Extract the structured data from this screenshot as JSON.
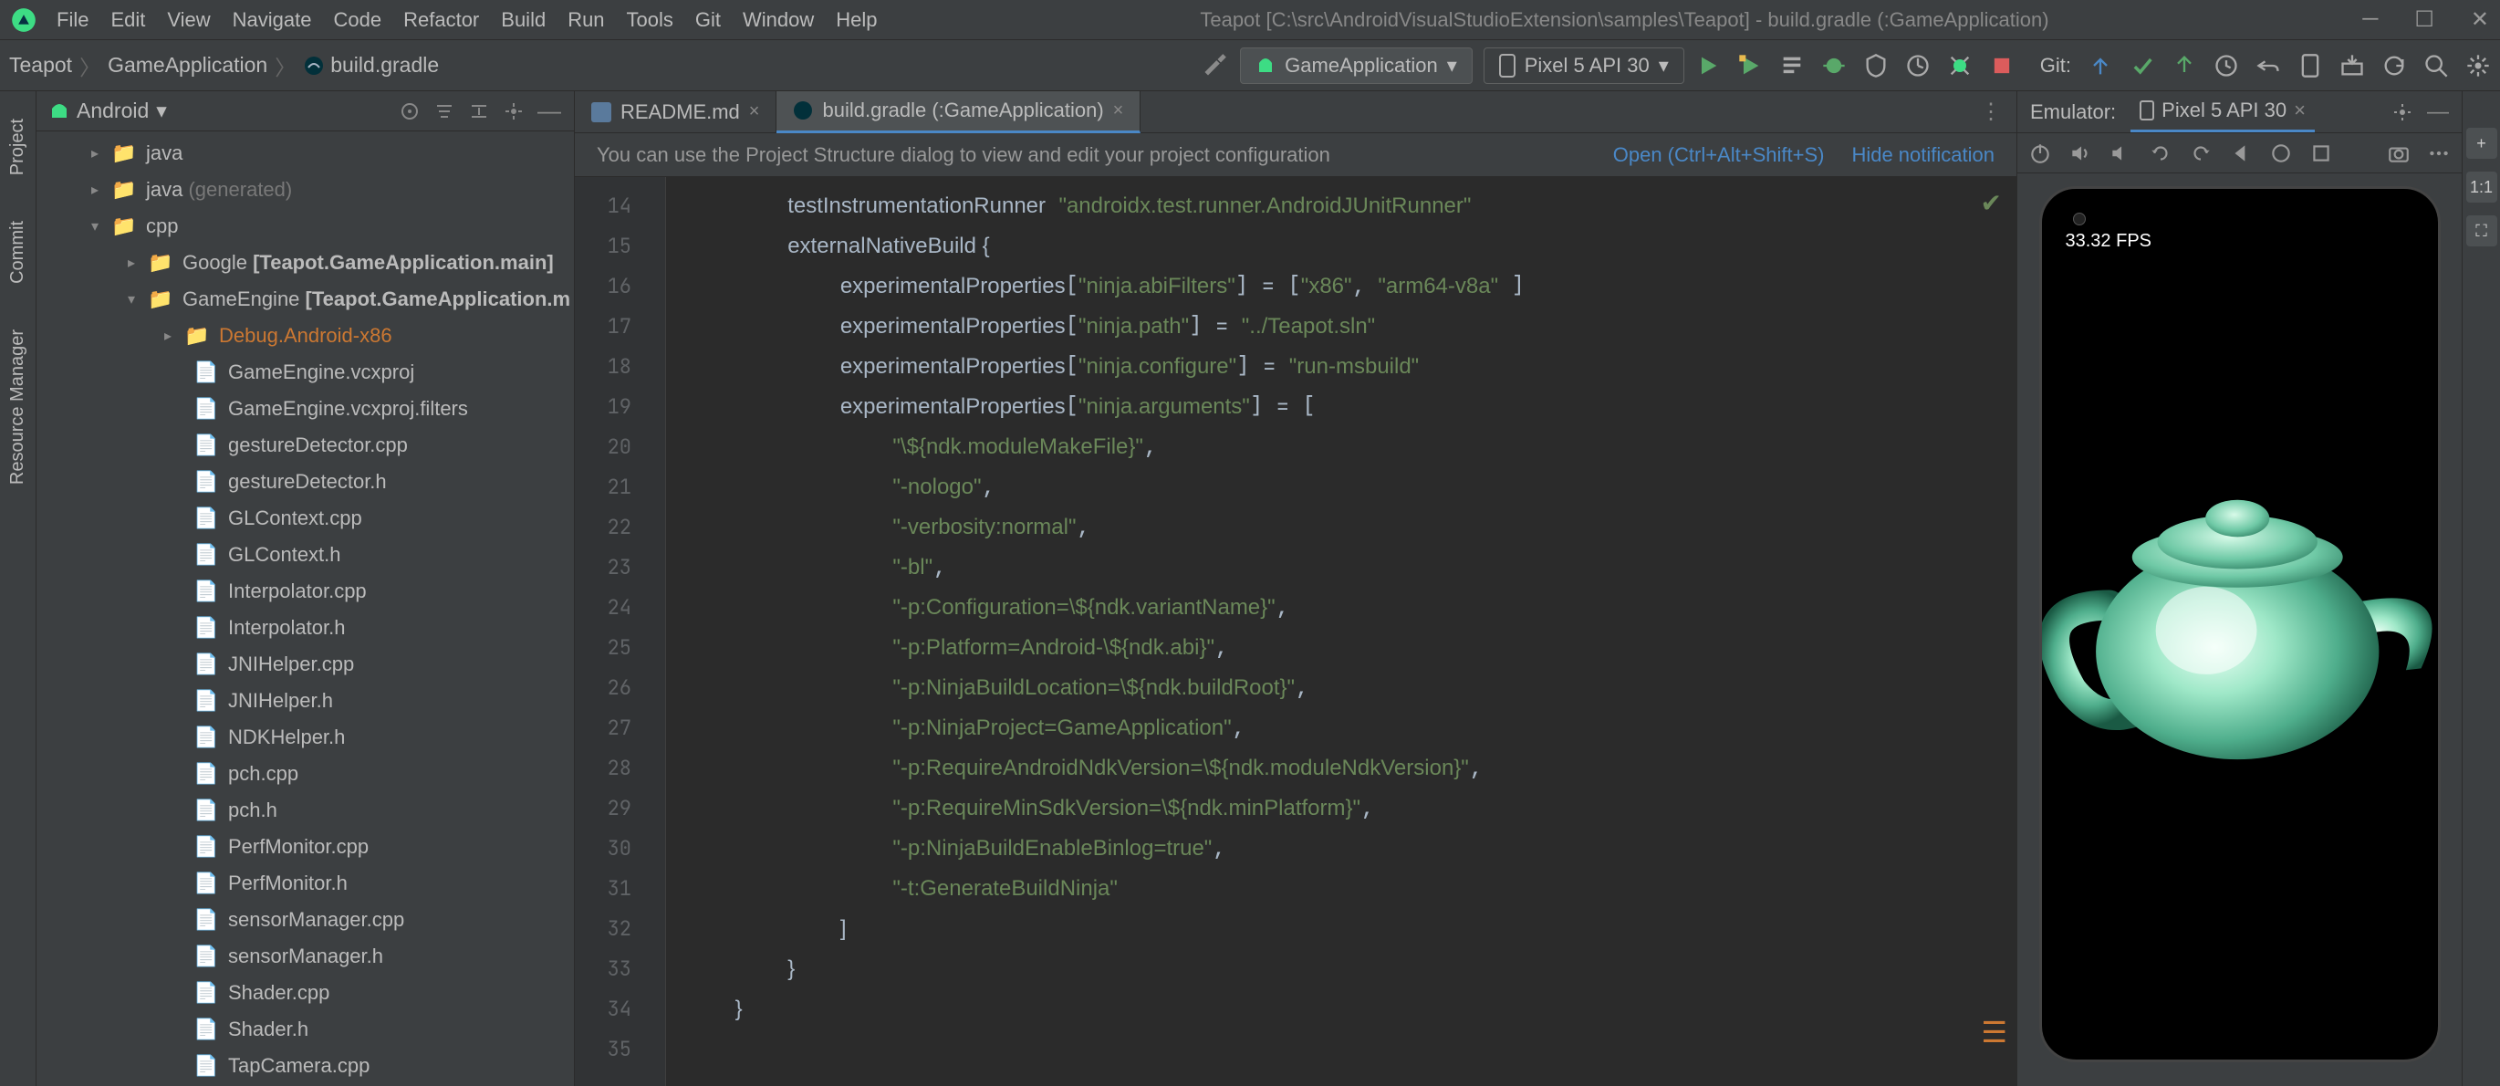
{
  "menus": [
    "File",
    "Edit",
    "View",
    "Navigate",
    "Code",
    "Refactor",
    "Build",
    "Run",
    "Tools",
    "Git",
    "Window",
    "Help"
  ],
  "window_title": "Teapot [C:\\src\\AndroidVisualStudioExtension\\samples\\Teapot] - build.gradle (:GameApplication)",
  "breadcrumb": {
    "project": "Teapot",
    "module": "GameApplication",
    "file": "build.gradle"
  },
  "run_config": "GameApplication",
  "device_selector": "Pixel 5 API 30",
  "git_label": "Git:",
  "project_panel": {
    "mode": "Android"
  },
  "tree": {
    "java": "java",
    "java_gen": "java",
    "java_gen_suffix": "(generated)",
    "cpp": "cpp",
    "google": "Google",
    "google_suffix": "[Teapot.GameApplication.main]",
    "gameengine": "GameEngine",
    "gameengine_suffix": "[Teapot.GameApplication.m",
    "debug": "Debug.Android-x86",
    "files": [
      "GameEngine.vcxproj",
      "GameEngine.vcxproj.filters",
      "gestureDetector.cpp",
      "gestureDetector.h",
      "GLContext.cpp",
      "GLContext.h",
      "Interpolator.cpp",
      "Interpolator.h",
      "JNIHelper.cpp",
      "JNIHelper.h",
      "NDKHelper.h",
      "pch.cpp",
      "pch.h",
      "PerfMonitor.cpp",
      "PerfMonitor.h",
      "sensorManager.cpp",
      "sensorManager.h",
      "Shader.cpp",
      "Shader.h",
      "TapCamera.cpp"
    ]
  },
  "tabs": [
    {
      "label": "README.md",
      "active": false
    },
    {
      "label": "build.gradle (:GameApplication)",
      "active": true
    }
  ],
  "notification": {
    "msg": "You can use the Project Structure dialog to view and edit your project configuration",
    "open": "Open (Ctrl+Alt+Shift+S)",
    "hide": "Hide notification"
  },
  "gutter_start": 14,
  "gutter_end": 35,
  "code": {
    "l14": {
      "indent": "        ",
      "id": "testInstrumentationRunner",
      "str": "\"androidx.test.runner.AndroidJUnitRunner\""
    },
    "l15": {
      "indent": "        ",
      "id": "externalNativeBuild",
      "br": " {"
    },
    "l16": {
      "indent": "            ",
      "id": "experimentalProperties",
      "op": "[",
      "str": "\"ninja.abiFilters\"",
      "op2": "] = [",
      "str2": "\"x86\"",
      "comma": ", ",
      "str3": "\"arm64-v8a\"",
      "close": " ]"
    },
    "l17": {
      "indent": "            ",
      "id": "experimentalProperties",
      "op": "[",
      "str": "\"ninja.path\"",
      "op2": "] = ",
      "str2": "\"../Teapot.sln\""
    },
    "l18": {
      "indent": "            ",
      "id": "experimentalProperties",
      "op": "[",
      "str": "\"ninja.configure\"",
      "op2": "] = ",
      "str2": "\"run-msbuild\""
    },
    "l19": {
      "indent": "            ",
      "id": "experimentalProperties",
      "op": "[",
      "str": "\"ninja.arguments\"",
      "op2": "] = ["
    },
    "l20": {
      "indent": "                ",
      "str": "\"\\${ndk.moduleMakeFile}\"",
      "comma": ","
    },
    "l21": {
      "indent": "                ",
      "str": "\"-nologo\"",
      "comma": ","
    },
    "l22": {
      "indent": "                ",
      "str": "\"-verbosity:normal\"",
      "comma": ","
    },
    "l23": {
      "indent": "                ",
      "str": "\"-bl\"",
      "comma": ","
    },
    "l24": {
      "indent": "                ",
      "str": "\"-p:Configuration=\\${ndk.variantName}\"",
      "comma": ","
    },
    "l25": {
      "indent": "                ",
      "str": "\"-p:Platform=Android-\\${ndk.abi}\"",
      "comma": ","
    },
    "l26": {
      "indent": "                ",
      "str": "\"-p:NinjaBuildLocation=\\${ndk.buildRoot}\"",
      "comma": ","
    },
    "l27": {
      "indent": "                ",
      "str": "\"-p:NinjaProject=GameApplication\"",
      "comma": ","
    },
    "l28": {
      "indent": "                ",
      "str": "\"-p:RequireAndroidNdkVersion=\\${ndk.moduleNdkVersion}\"",
      "comma": ","
    },
    "l29": {
      "indent": "                ",
      "str": "\"-p:RequireMinSdkVersion=\\${ndk.minPlatform}\"",
      "comma": ","
    },
    "l30": {
      "indent": "                ",
      "str": "\"-p:NinjaBuildEnableBinlog=true\"",
      "comma": ","
    },
    "l31": {
      "indent": "                ",
      "str": "\"-t:GenerateBuildNinja\""
    },
    "l32": {
      "indent": "            ",
      "br": "]"
    },
    "l33": {
      "indent": "        ",
      "br": "}"
    },
    "l34": {
      "indent": "    ",
      "br": "}"
    }
  },
  "emulator": {
    "label": "Emulator:",
    "device": "Pixel 5 API 30",
    "fps": "33.32 FPS"
  },
  "right_buttons": [
    "+",
    "1:1",
    "⛶"
  ]
}
